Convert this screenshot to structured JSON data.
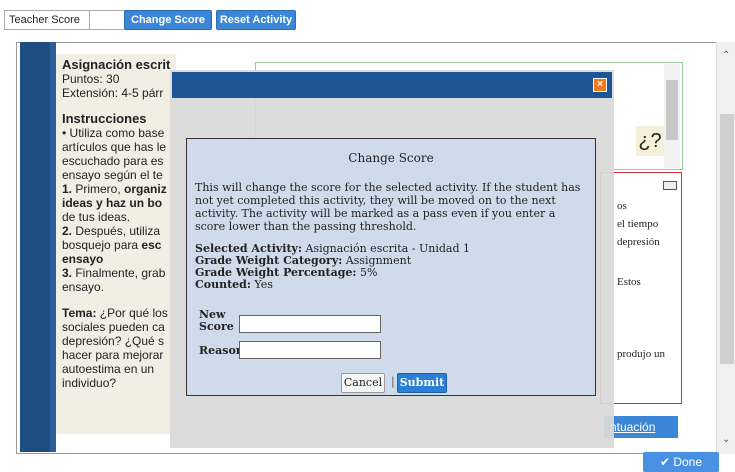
{
  "toolbar": {
    "teacher_score_label": "Teacher Score",
    "change_score_btn": "Change Score",
    "reset_activity_btn": "Reset Activity"
  },
  "assignment": {
    "title": "Asignación escrit",
    "points": "Puntos: 30",
    "extension": "Extensión: 4-5 párr",
    "instructions_heading": "Instrucciones",
    "body_lines": [
      "• Utiliza como base",
      "artículos que has le",
      "escuchado para es",
      "ensayo según el te"
    ],
    "step1_a": "1.",
    "step1_b": " Primero, ",
    "step1_bold": "organiz",
    "step1_c": "ideas y haz un bo",
    "step1_d": "de tus ideas.",
    "step2_a": "2.",
    "step2_b": " Después, utiliza",
    "step2_c": "bosquejo para ",
    "step2_bold": "esc",
    "step2_d": "ensayo",
    "step3_a": "3.",
    "step3_b": " Finalmente, grab",
    "step3_c": "ensayo.",
    "tema_label": "Tema:",
    "tema_lines": [
      " ¿Por qué los",
      "sociales pueden ca",
      "depresión? ¿Qué s",
      "hacer para mejorar",
      "autoestima en un",
      "individuo?"
    ]
  },
  "side_text": {
    "lines": [
      "os",
      "el tiempo",
      "depresión",
      "",
      "",
      "Estos",
      "",
      "",
      "",
      "",
      "produjo un"
    ]
  },
  "question_icon": "¿?",
  "puntuacion_link": "ntuación",
  "modal": {
    "title": "Change Score",
    "message": "This will change the score for the selected activity. If the student has not yet completed this activity, they will be moved on to the next activity. The activity will be marked as a pass even if you enter a score lower than the passing threshold.",
    "selected_activity_label": "Selected Activity:",
    "selected_activity_value": " Asignación escrita - Unidad 1",
    "grade_weight_category_label": "Grade Weight Category:",
    "grade_weight_category_value": " Assignment",
    "grade_weight_percentage_label": "Grade Weight Percentage:",
    "grade_weight_percentage_value": " 5%",
    "counted_label": "Counted:",
    "counted_value": " Yes",
    "new_score_label_1": "New",
    "new_score_label_2": "Score",
    "reason_label": "Reason",
    "cancel_btn": "Cancel",
    "separator": "|",
    "submit_btn": "Submit",
    "close_glyph": "×"
  },
  "done_btn": "✔ Done",
  "colors": {
    "accent": "#3b86d6",
    "header_blue": "#1e5595",
    "modal_bg": "#cfdbea",
    "close_orange": "#f07b1c"
  }
}
